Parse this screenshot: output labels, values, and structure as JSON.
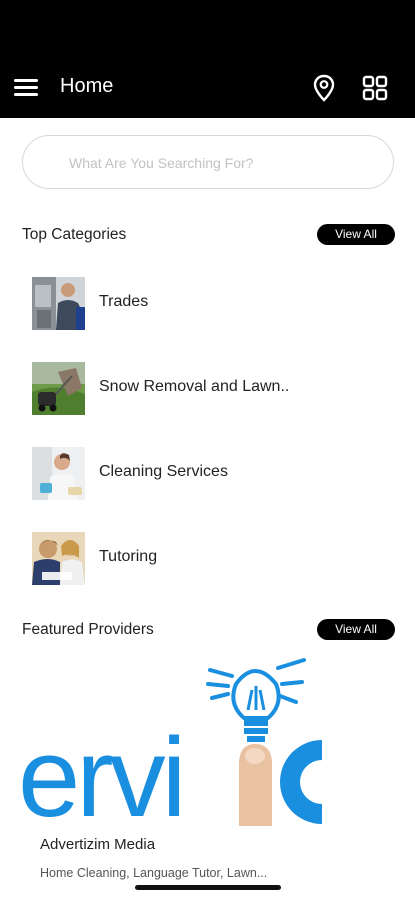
{
  "app_bar": {
    "title": "Home",
    "icons": [
      "hamburger-menu-icon",
      "location-pin-icon",
      "grid-apps-icon"
    ]
  },
  "search": {
    "placeholder": "What Are You Searching For?",
    "value": ""
  },
  "top_categories": {
    "title": "Top Categories",
    "view_all_label": "View All",
    "items": [
      {
        "label": "Trades"
      },
      {
        "label": "Snow Removal and Lawn.."
      },
      {
        "label": "Cleaning Services"
      },
      {
        "label": "Tutoring"
      }
    ]
  },
  "featured_providers": {
    "title": "Featured Providers",
    "view_all_label": "View All",
    "items": [
      {
        "banner_text": "ervi",
        "name": "Advertizim Media",
        "tags": "Home Cleaning, Language Tutor, Lawn..."
      }
    ]
  },
  "colors": {
    "bar": "#000000",
    "accent_blue": "#1a8fe0",
    "text": "#222222"
  }
}
